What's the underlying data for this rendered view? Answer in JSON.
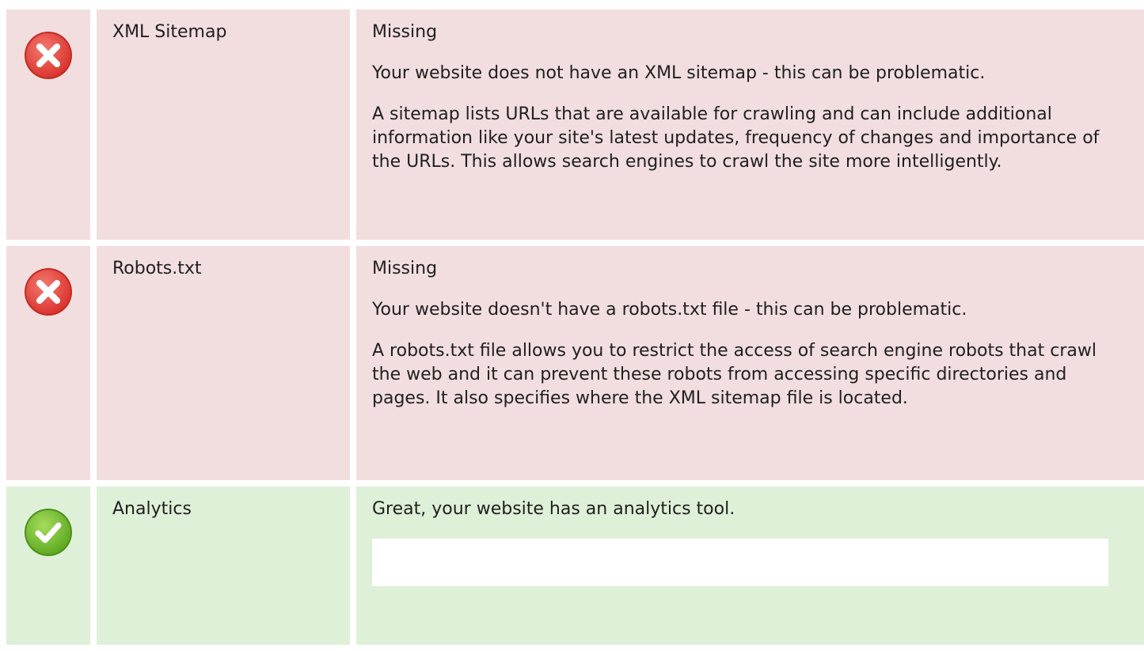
{
  "rows": [
    {
      "status": "error",
      "icon": "error-x-icon",
      "name": "XML Sitemap",
      "status_text": "Missing",
      "paragraphs": [
        "Your website does not have an XML sitemap - this can be problematic.",
        "A sitemap lists URLs that are available for crawling and can include additional information like your site's latest updates, frequency of changes and importance of the URLs. This allows search engines to crawl the site more intelligently."
      ]
    },
    {
      "status": "error",
      "icon": "error-x-icon",
      "name": "Robots.txt",
      "status_text": "Missing",
      "paragraphs": [
        "Your website doesn't have a robots.txt file - this can be problematic.",
        "A robots.txt file allows you to restrict the access of search engine robots that crawl the web and it can prevent these robots from accessing specific directories and pages. It also specifies where the XML sitemap file is located."
      ]
    },
    {
      "status": "ok",
      "icon": "check-icon",
      "name": "Analytics",
      "status_text": "Great, your website has an analytics tool."
    }
  ],
  "colors": {
    "error_bg": "#f2dedf",
    "ok_bg": "#dff0d8",
    "error_icon": "#e8403a",
    "ok_icon": "#6ab82c"
  }
}
